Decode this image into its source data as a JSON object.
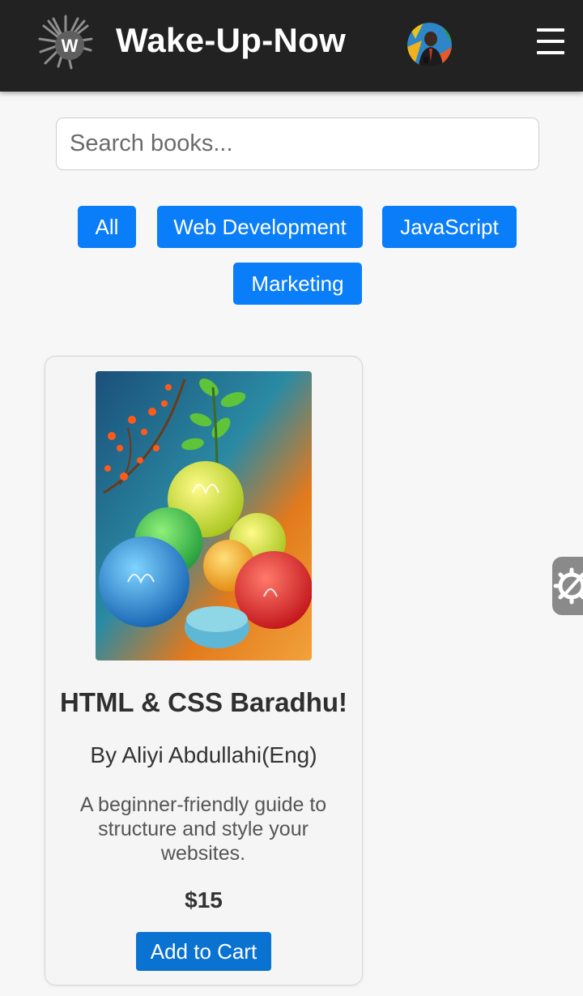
{
  "header": {
    "logo_letter": "W",
    "brand": "Wake-Up-Now",
    "menu_icon": "hamburger-menu-icon",
    "avatar_icon": "user-avatar"
  },
  "search": {
    "placeholder": "Search books...",
    "value": ""
  },
  "categories": [
    "All",
    "Web Development",
    "JavaScript",
    "Marketing"
  ],
  "books": [
    {
      "title": "HTML & CSS Baradhu!",
      "author": "By Aliyi Abdullahi(Eng)",
      "description": "A beginner-friendly guide to structure and style your websites.",
      "price": "$15",
      "button": "Add to Cart"
    }
  ],
  "colors": {
    "header_bg": "#222222",
    "chip_bg": "#0a7df8",
    "cart_button_bg": "#0a72d0",
    "page_bg": "#f7f7f7"
  },
  "floating": {
    "settings_icon": "gear-icon"
  }
}
